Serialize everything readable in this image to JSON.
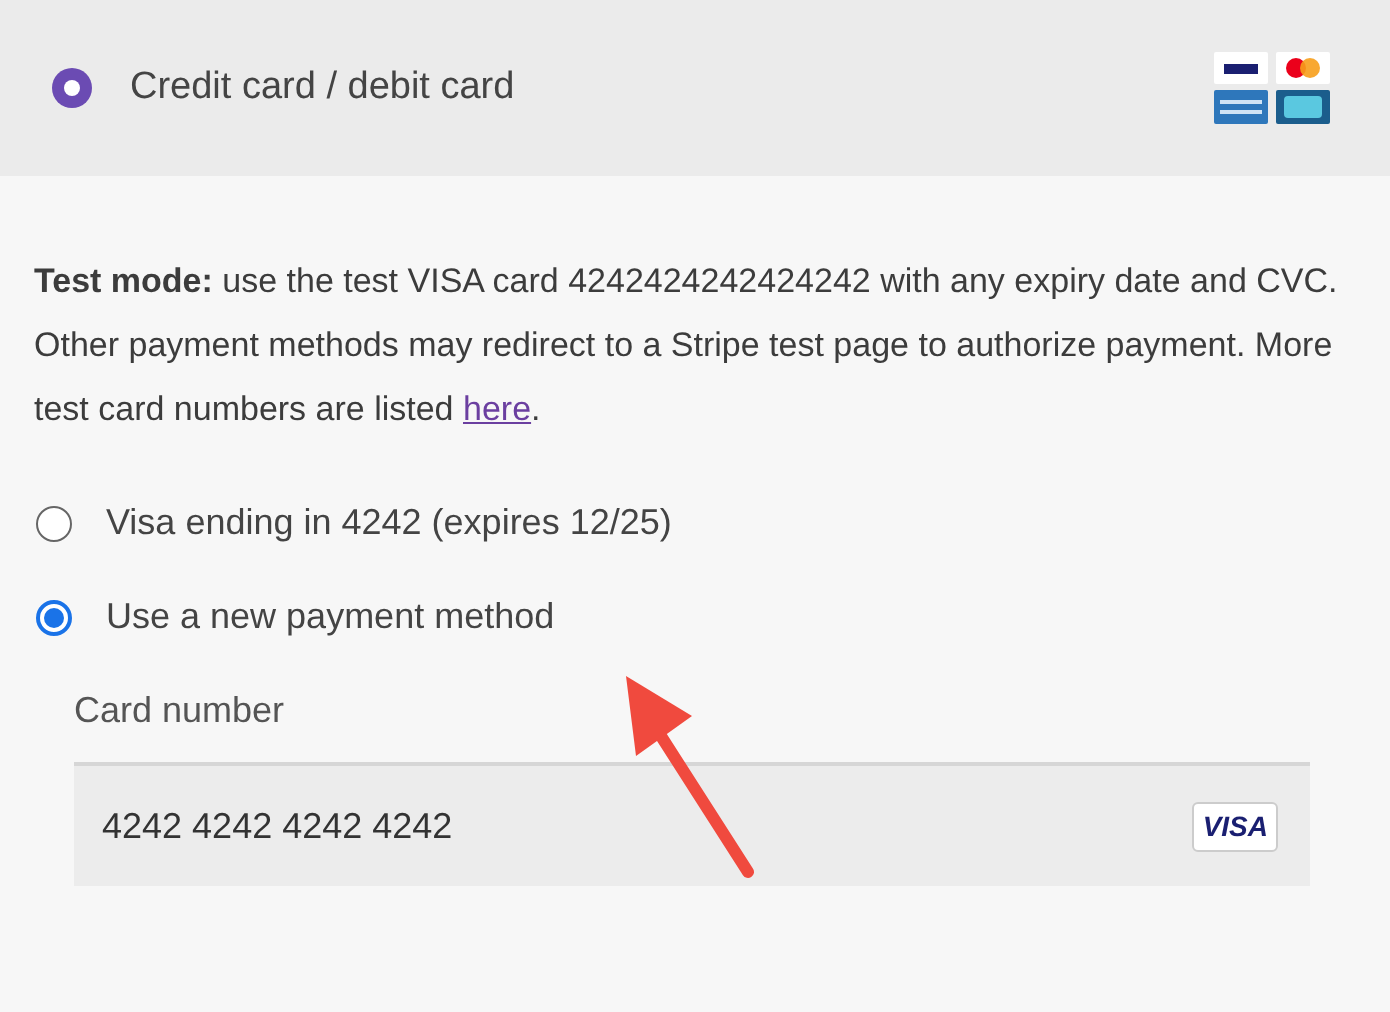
{
  "gateway": {
    "label": "Credit card / debit card",
    "selected": true
  },
  "notice": "**Test mode:** use the test VISA card 4242424242424242 with any expiry date and CVC. Other payment methods may redirect to a Stripe test page to authorize payment. More test card numbers are listed",
  "notice_link": "here",
  "notice_end": ".",
  "options": [
    {
      "label": "Visa ending in 4242 (expires 12/25)",
      "selected": false
    },
    {
      "label": "Use a new payment method",
      "selected": true
    }
  ],
  "card_field": {
    "label": "Card number",
    "value": "4242 4242 4242 4242",
    "brand": "VISA"
  }
}
